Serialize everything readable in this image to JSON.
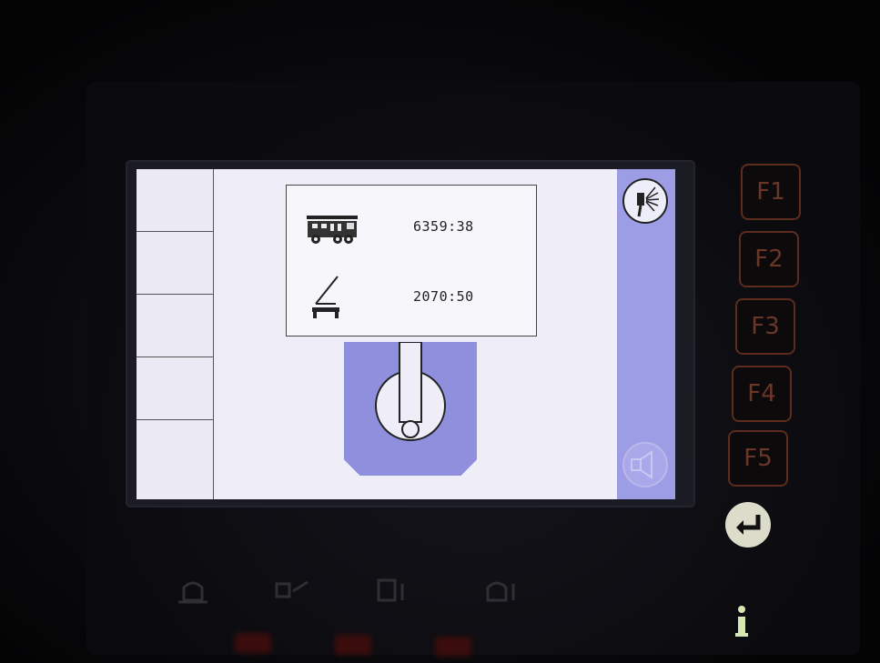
{
  "screen": {
    "readouts": [
      {
        "icon": "fire-truck-icon",
        "value": "6359:38"
      },
      {
        "icon": "aerial-ladder-icon",
        "value": "2070:50"
      }
    ],
    "right_icons": [
      "water-nozzle-icon",
      "horn-icon"
    ],
    "joystick": "joystick-icon"
  },
  "keys": {
    "f1": "F1",
    "f2": "F2",
    "f3": "F3",
    "f4": "F4",
    "f5": "F5"
  },
  "colors": {
    "screen_bg": "#efeef8",
    "accent": "#9d9de6",
    "key_border": "#5c2c1e"
  }
}
